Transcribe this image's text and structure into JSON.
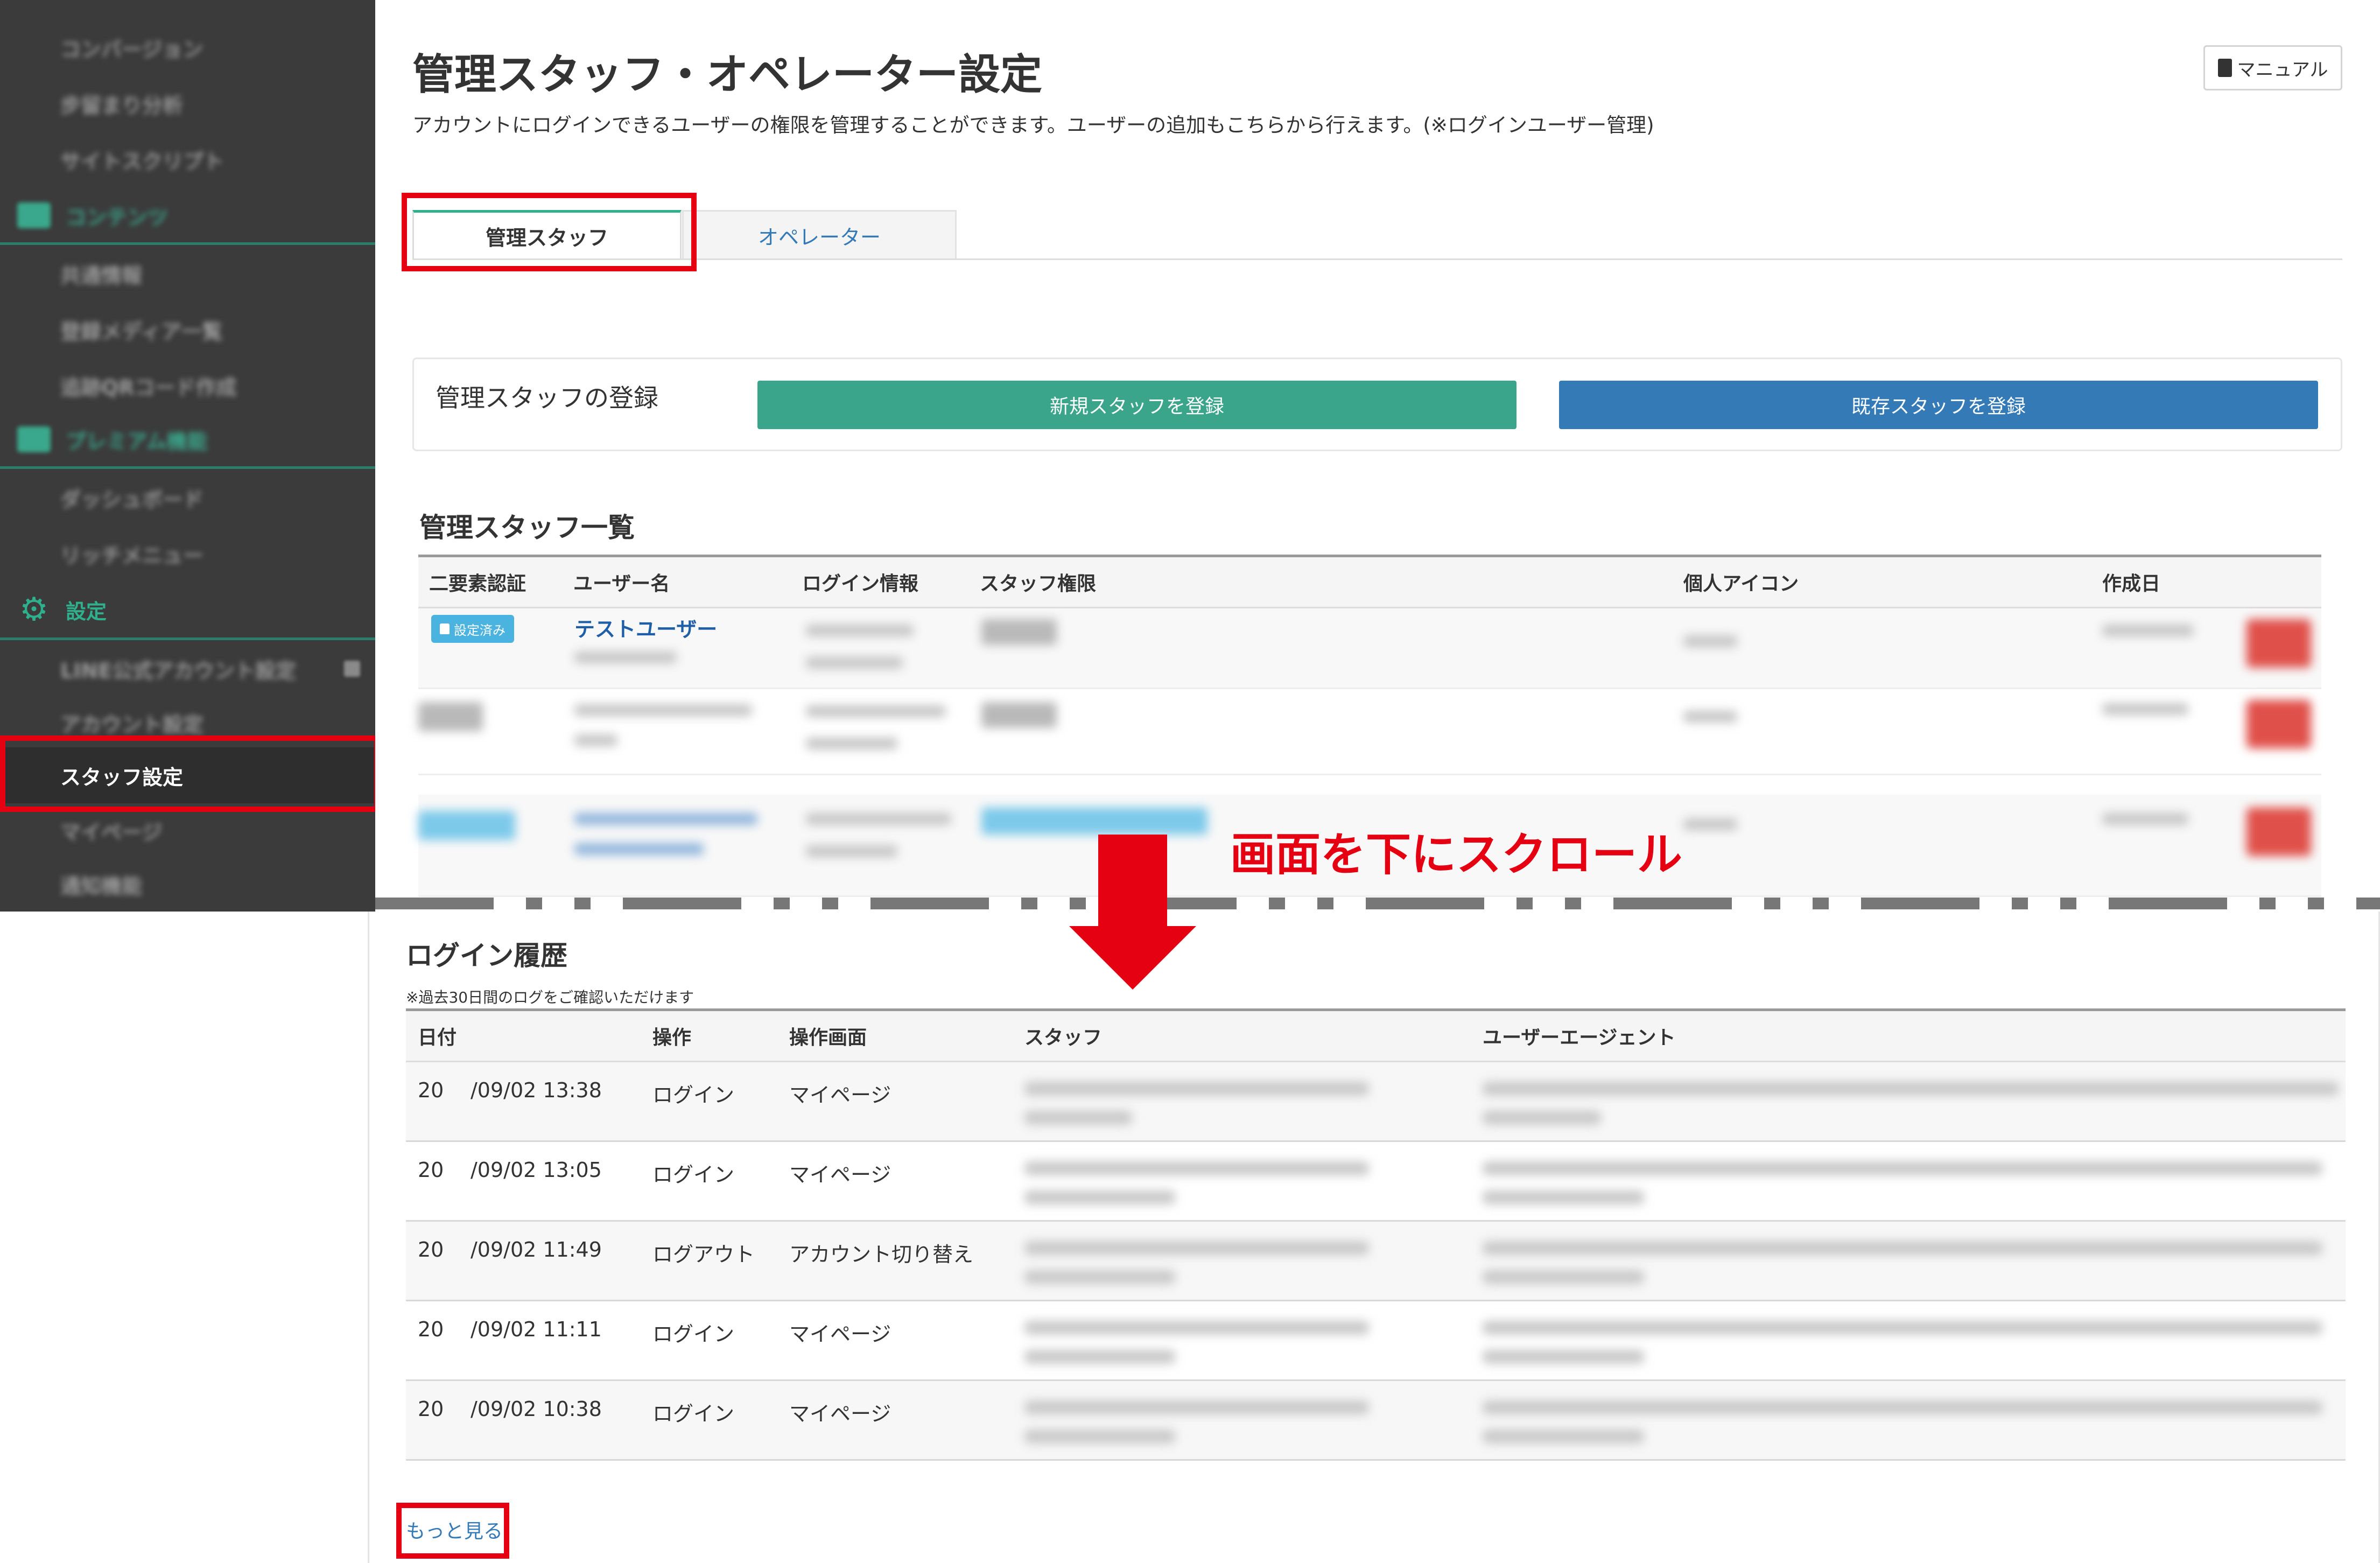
{
  "sidebar": {
    "items": [
      {
        "label": "コンバージョン"
      },
      {
        "label": "步留まり分析"
      },
      {
        "label": "サイトスクリプト"
      },
      {
        "label": "コンテンツ"
      },
      {
        "label": "共通情報"
      },
      {
        "label": "登録メディア一覧"
      },
      {
        "label": "追跡QRコード作成"
      },
      {
        "label": "プレミアム機能"
      },
      {
        "label": "ダッシュボード"
      },
      {
        "label": "リッチメニュー"
      },
      {
        "label": "設定"
      },
      {
        "label": "LINE公式アカウント設定"
      },
      {
        "label": "アカウント設定"
      },
      {
        "label": "スタッフ設定"
      },
      {
        "label": "マイページ"
      },
      {
        "label": "通知機能"
      }
    ]
  },
  "header": {
    "title": "管理スタッフ・オペレーター設定",
    "description": "アカウントにログインできるユーザーの権限を管理することができます。ユーザーの追加もこちらから行えます。(※ログインユーザー管理)",
    "manual_label": "マニュアル"
  },
  "tabs": [
    {
      "label": "管理スタッフ"
    },
    {
      "label": "オペレーター"
    }
  ],
  "registration": {
    "label": "管理スタッフの登録",
    "new_button": "新規スタッフを登録",
    "existing_button": "既存スタッフを登録"
  },
  "staff_list": {
    "title": "管理スタッフ一覧",
    "columns": [
      "二要素認証",
      "ユーザー名",
      "ログイン情報",
      "スタッフ権限",
      "個人アイコン",
      "作成日"
    ],
    "rows": [
      {
        "twofa": "設定済み",
        "username": "テストユーザー"
      }
    ]
  },
  "annotation": {
    "scroll_text": "画面を下にスクロール"
  },
  "login_history": {
    "title": "ログイン履歴",
    "note": "※過去30日間のログをご確認いただけます",
    "columns": [
      "日付",
      "操作",
      "操作画面",
      "スタッフ",
      "ユーザーエージェント"
    ],
    "rows": [
      {
        "date_prefix": "20",
        "date": "/09/02 13:38",
        "action": "ログイン",
        "screen": "マイページ"
      },
      {
        "date_prefix": "20",
        "date": "/09/02 13:05",
        "action": "ログイン",
        "screen": "マイページ"
      },
      {
        "date_prefix": "20",
        "date": "/09/02 11:49",
        "action": "ログアウト",
        "screen": "アカウント切り替え"
      },
      {
        "date_prefix": "20",
        "date": "/09/02 11:11",
        "action": "ログイン",
        "screen": "マイページ"
      },
      {
        "date_prefix": "20",
        "date": "/09/02 10:38",
        "action": "ログイン",
        "screen": "マイページ"
      }
    ],
    "more_link": "もっと見る"
  },
  "colors": {
    "accent_green": "#3aa58a",
    "accent_blue": "#337ab7",
    "highlight_red": "#e50012",
    "sidebar_bg": "#3b3b3b"
  },
  "icons": {
    "manual": "book-icon",
    "settings": "gear-icon",
    "lock": "lock-icon",
    "arrow": "arrow-down-icon"
  }
}
